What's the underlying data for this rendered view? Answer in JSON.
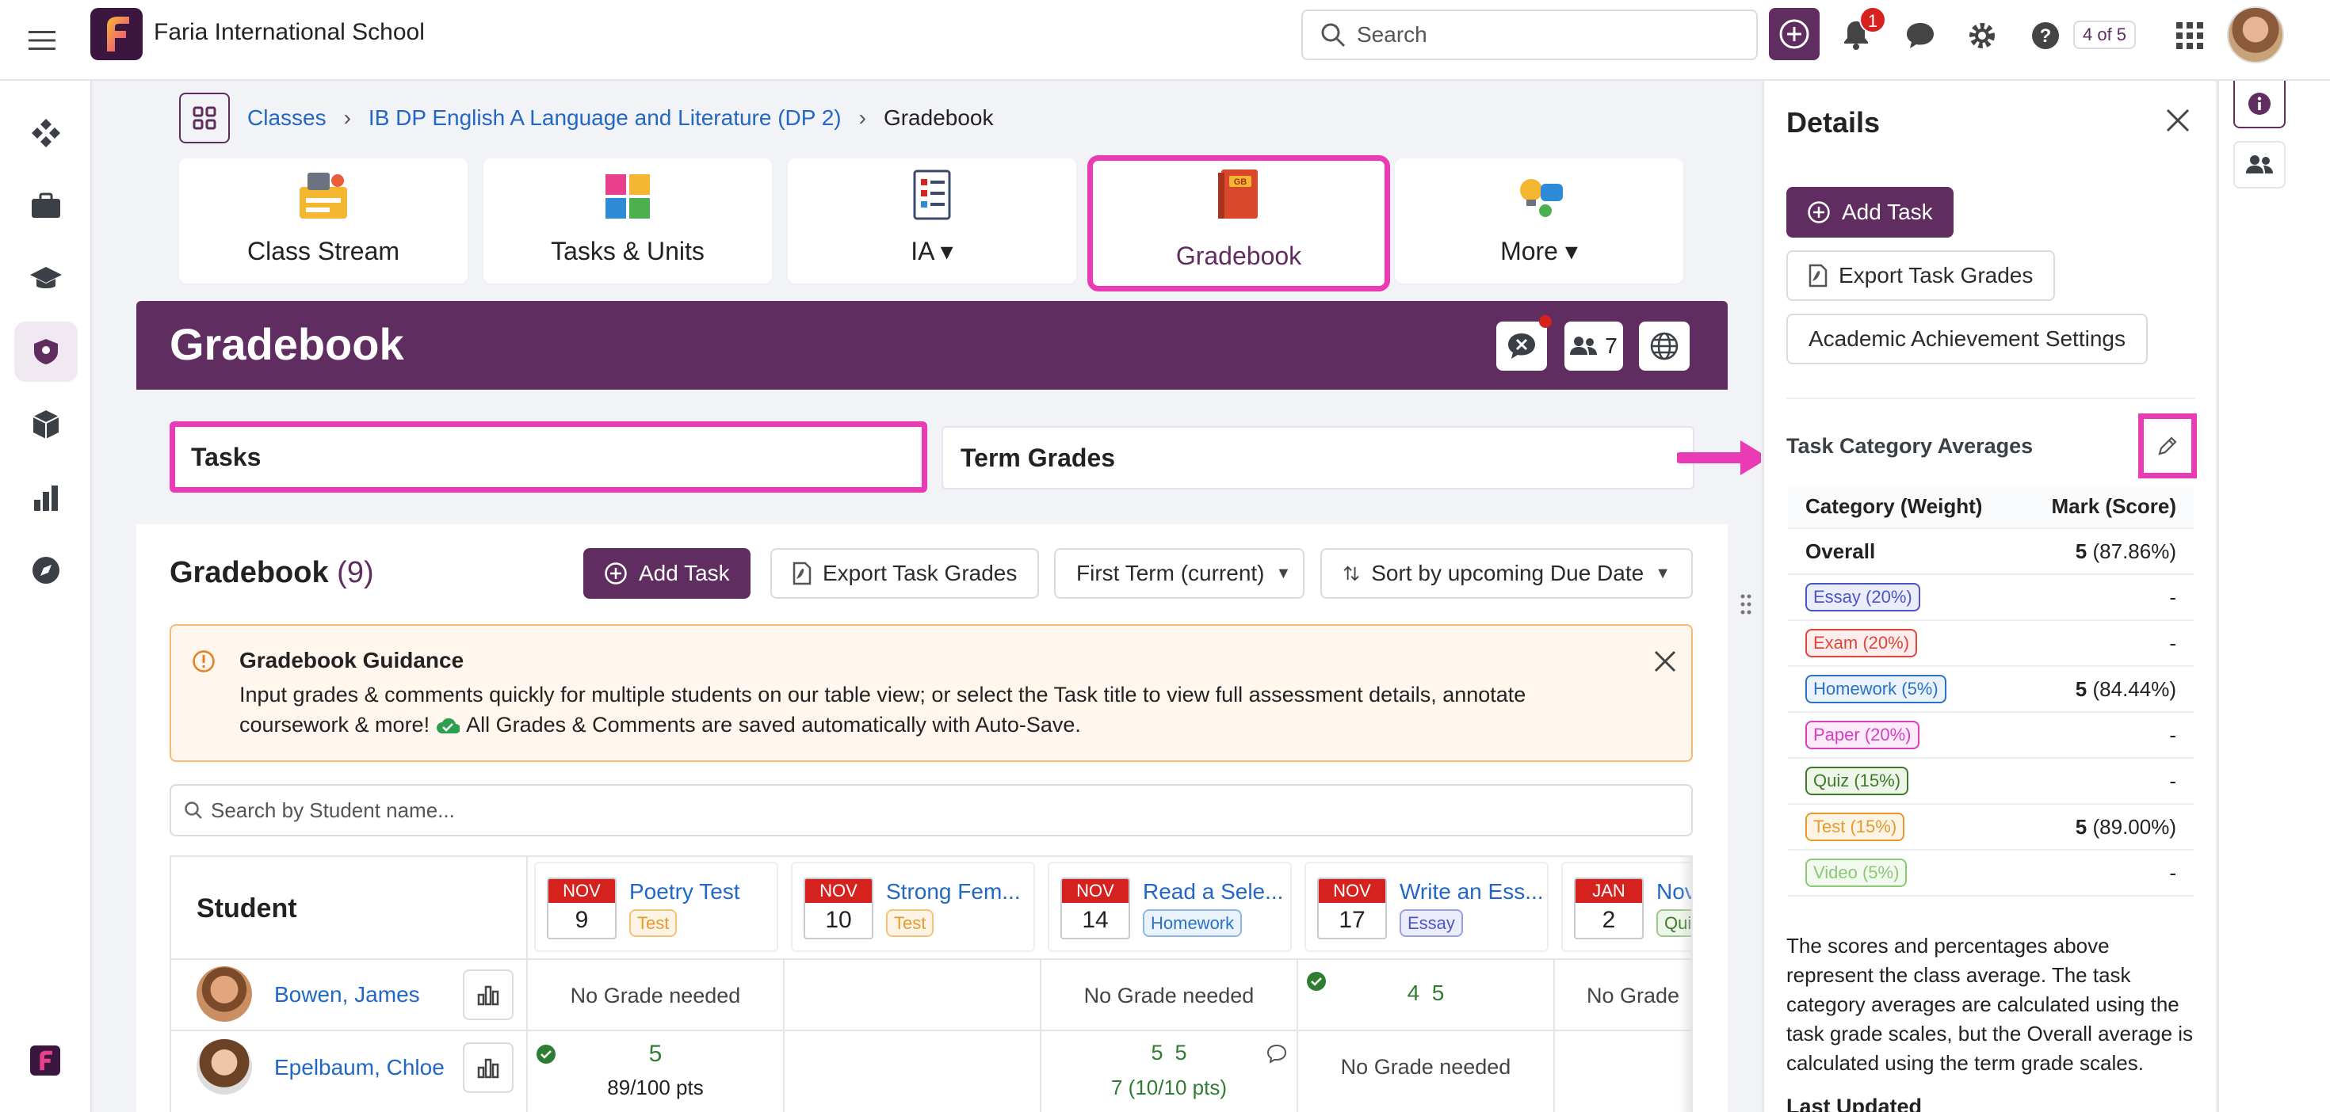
{
  "topbar": {
    "school_name": "Faria International School",
    "search_placeholder": "Search",
    "notification_count": "1",
    "pager": "4 of 5",
    "brand_color": "#5f2d5f"
  },
  "breadcrumb": {
    "items": [
      "Classes",
      "IB DP English A Language and Literature (DP 2)",
      "Gradebook"
    ]
  },
  "class_nav": {
    "cards": [
      {
        "label": "Class Stream"
      },
      {
        "label": "Tasks & Units"
      },
      {
        "label": "IA ▾"
      },
      {
        "label": "Gradebook"
      },
      {
        "label": "More ▾"
      }
    ]
  },
  "header": {
    "title": "Gradebook",
    "students_count": "7"
  },
  "tabs": [
    "Tasks",
    "Term Grades"
  ],
  "gradebook": {
    "title": "Gradebook",
    "count": "(9)",
    "add_task": "Add Task",
    "export": "Export Task Grades",
    "term_select": "First Term (current)",
    "sort_select": "Sort by upcoming Due Date"
  },
  "guidance": {
    "title": "Gradebook Guidance",
    "line1": "Input grades & comments quickly for multiple students on our table view; or select the Task title to view full assessment details, annotate",
    "line2_a": "coursework & more!",
    "line2_b": "All Grades & Comments are saved automatically with Auto-Save."
  },
  "student_search_placeholder": "Search by Student name...",
  "table": {
    "student_header": "Student",
    "tasks": [
      {
        "month": "NOV",
        "day": "9",
        "title": "Poetry Test",
        "category": "Test"
      },
      {
        "month": "NOV",
        "day": "10",
        "title": "Strong Fem...",
        "category": "Test"
      },
      {
        "month": "NOV",
        "day": "14",
        "title": "Read a Sele...",
        "category": "Homework"
      },
      {
        "month": "NOV",
        "day": "17",
        "title": "Write an Ess...",
        "category": "Essay"
      },
      {
        "month": "JAN",
        "day": "2",
        "title": "Nov",
        "category": "Qui"
      }
    ],
    "students": [
      {
        "name": "Bowen, James",
        "cells": [
          "No Grade needed",
          "",
          "No Grade needed",
          "4  5",
          "No Grade"
        ]
      },
      {
        "name": "Epelbaum, Chloe",
        "cells": [
          "5",
          "",
          "5  5",
          "No Grade needed",
          ""
        ],
        "sub": {
          "c0": "89/100 pts",
          "c2": "7 (10/10 pts)"
        }
      }
    ]
  },
  "details": {
    "title": "Details",
    "add_task": "Add Task",
    "export": "Export Task Grades",
    "settings": "Academic Achievement Settings",
    "averages_title": "Task Category Averages",
    "col_category": "Category (Weight)",
    "col_mark": "Mark (Score)",
    "overall_label": "Overall",
    "overall_mark": "5",
    "overall_score": "(87.86%)",
    "categories": [
      {
        "label": "Essay (20%)",
        "mark": "",
        "score": "-",
        "color": "#4a55c8",
        "bg": "#ecedfb"
      },
      {
        "label": "Exam (20%)",
        "mark": "",
        "score": "-",
        "color": "#e0453a",
        "bg": "#fdeeed"
      },
      {
        "label": "Homework (5%)",
        "mark": "5",
        "score": "(84.44%)",
        "color": "#2b73c2",
        "bg": "#eaf2fb"
      },
      {
        "label": "Paper (20%)",
        "mark": "",
        "score": "-",
        "color": "#d93dc7",
        "bg": "#fcebf9"
      },
      {
        "label": "Quiz (15%)",
        "mark": "",
        "score": "-",
        "color": "#3f7a2c",
        "bg": "#eef6e9"
      },
      {
        "label": "Test (15%)",
        "mark": "5",
        "score": "(89.00%)",
        "color": "#e59a2b",
        "bg": "#fdf4e6"
      },
      {
        "label": "Video (5%)",
        "mark": "",
        "score": "-",
        "color": "#8cc876",
        "bg": "#f2f9ee"
      }
    ],
    "note": "The scores and percentages above represent the class average. The task category averages are calculated using the task grade scales, but the Overall average is calculated using the term grade scales.",
    "last_updated": "Last Updated"
  }
}
